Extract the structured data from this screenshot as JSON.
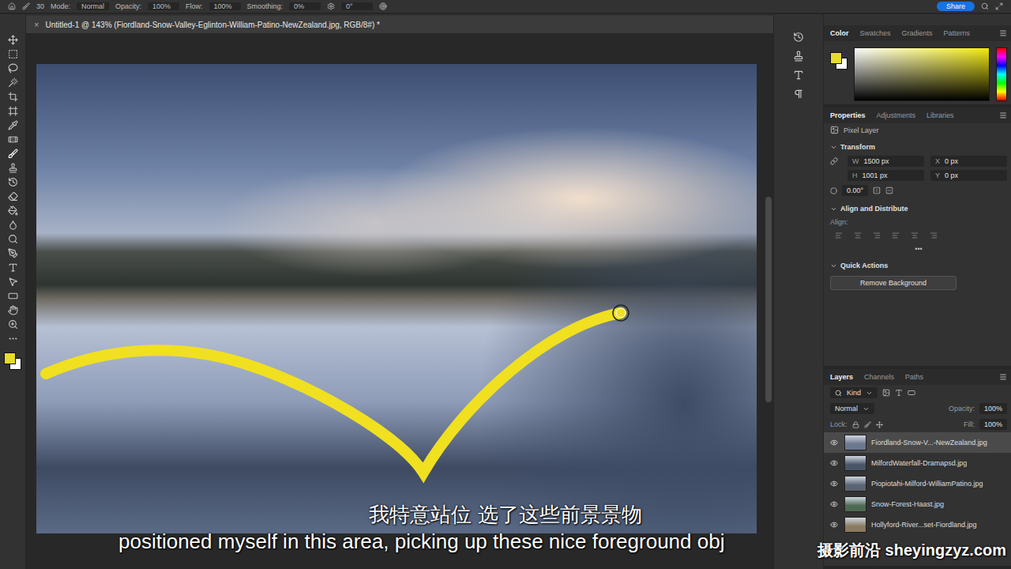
{
  "options_bar": {
    "brush_size": "30",
    "mode_label": "Mode:",
    "mode": "Normal",
    "opacity_label": "Opacity:",
    "opacity": "100%",
    "flow_label": "Flow:",
    "flow": "100%",
    "smoothing_label": "Smoothing:",
    "smoothing": "0%",
    "angle": "0°",
    "share": "Share"
  },
  "document_tab": {
    "title": "Untitled-1 @ 143% (Fiordland-Snow-Valley-Eglinton-William-Patino-NewZealand.jpg, RGB/8#) *",
    "close": "×"
  },
  "color_panel": {
    "tabs": [
      {
        "label": "Color",
        "selected": true
      },
      {
        "label": "Swatches",
        "selected": false
      },
      {
        "label": "Gradients",
        "selected": false
      },
      {
        "label": "Patterns",
        "selected": false
      }
    ],
    "foreground": "#e6dc2a",
    "background": "#ffffff"
  },
  "properties_panel": {
    "tabs": [
      {
        "label": "Properties",
        "selected": true
      },
      {
        "label": "Adjustments",
        "selected": false
      },
      {
        "label": "Libraries",
        "selected": false
      }
    ],
    "layer_kind": "Pixel Layer",
    "transform": {
      "title": "Transform",
      "w_label": "W",
      "w": "1500 px",
      "x_label": "X",
      "x": "0 px",
      "h_label": "H",
      "h": "1001 px",
      "y_label": "Y",
      "y": "0 px",
      "angle": "0.00°"
    },
    "align": {
      "title": "Align and Distribute",
      "label": "Align:",
      "more": "•••"
    },
    "quick_actions": {
      "title": "Quick Actions",
      "button": "Remove Background"
    }
  },
  "layers_panel": {
    "tabs": [
      {
        "label": "Layers",
        "selected": true
      },
      {
        "label": "Channels",
        "selected": false
      },
      {
        "label": "Paths",
        "selected": false
      }
    ],
    "filter": "Kind",
    "blend_mode": "Normal",
    "opacity_label": "Opacity:",
    "opacity": "100%",
    "lock_label": "Lock:",
    "fill_label": "Fill:",
    "fill": "100%",
    "layers": [
      {
        "name": "Fiordland-Snow-V...-NewZealand.jpg",
        "visible": true,
        "selected": true,
        "color": "#6a7890"
      },
      {
        "name": "MilfordWaterfall-Dramapsd.jpg",
        "visible": true,
        "selected": false,
        "color": "#4a5668"
      },
      {
        "name": "Piopiotahi-Milford-WilliamPatino.jpg",
        "visible": true,
        "selected": false,
        "color": "#5a6472"
      },
      {
        "name": "Snow-Forest-Haast.jpg",
        "visible": true,
        "selected": false,
        "color": "#4e6a52"
      },
      {
        "name": "Hollyford-River...set-Fiordland.jpg",
        "visible": true,
        "selected": false,
        "color": "#8a7a60"
      }
    ]
  },
  "subtitles": {
    "zh": "我特意站位 选了这些前景景物",
    "en": "positioned myself in this area, picking up these nice foreground obj"
  },
  "watermark": "摄影前沿 sheyingzyz.com"
}
